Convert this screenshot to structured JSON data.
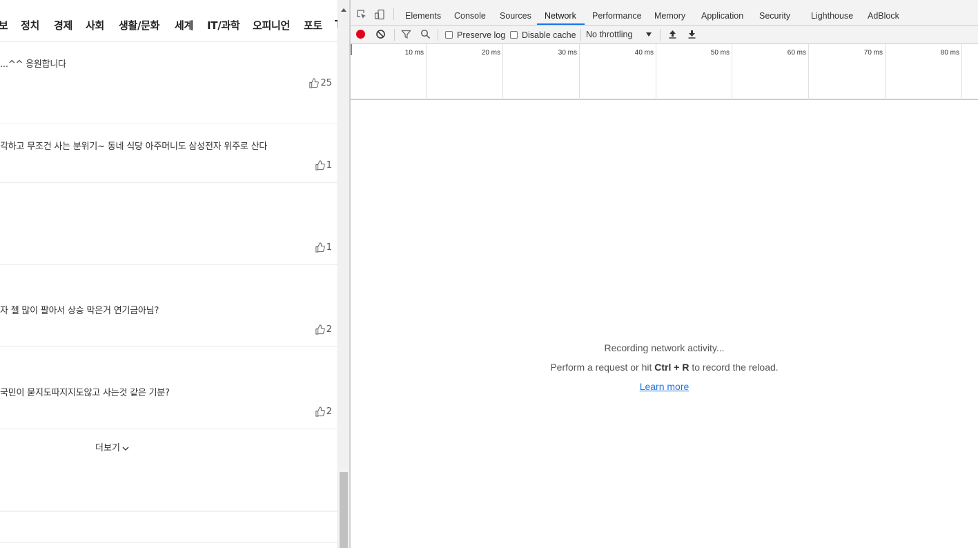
{
  "page": {
    "nav": [
      "보",
      "정치",
      "경제",
      "사회",
      "생활/문화",
      "세계",
      "IT/과학",
      "오피니언",
      "포토",
      "T"
    ],
    "comments": [
      {
        "text": "...^^ 응원합니다",
        "likes": "25"
      },
      {
        "text": "각하고 무조건 사는 분위기~ 동네 식당 아주머니도 삼성전자 위주로 산다",
        "likes": "1"
      },
      {
        "text": "",
        "likes": "1"
      },
      {
        "text": "자 젤 많이 팔아서 상승 막은거 연기금아님?",
        "likes": "2"
      },
      {
        "text": "국민이 묻지도따지지도않고 사는것 같은 기분?",
        "likes": "2"
      }
    ],
    "more_label": "더보기"
  },
  "devtools": {
    "tabs": [
      "Elements",
      "Console",
      "Sources",
      "Network",
      "Performance",
      "Memory",
      "Application",
      "Security",
      "Lighthouse",
      "AdBlock"
    ],
    "active_tab": "Network",
    "toolbar": {
      "preserve_log": "Preserve log",
      "disable_cache": "Disable cache",
      "throttling": "No throttling"
    },
    "timeline_ticks": [
      "10 ms",
      "20 ms",
      "30 ms",
      "40 ms",
      "50 ms",
      "60 ms",
      "70 ms",
      "80 ms"
    ],
    "empty": {
      "title": "Recording network activity...",
      "hint_prefix": "Perform a request or hit ",
      "hint_shortcut": "Ctrl + R",
      "hint_suffix": " to record the reload.",
      "learn_more": "Learn more"
    },
    "colors": {
      "accent": "#1a73e8",
      "record": "#e4001b"
    }
  }
}
